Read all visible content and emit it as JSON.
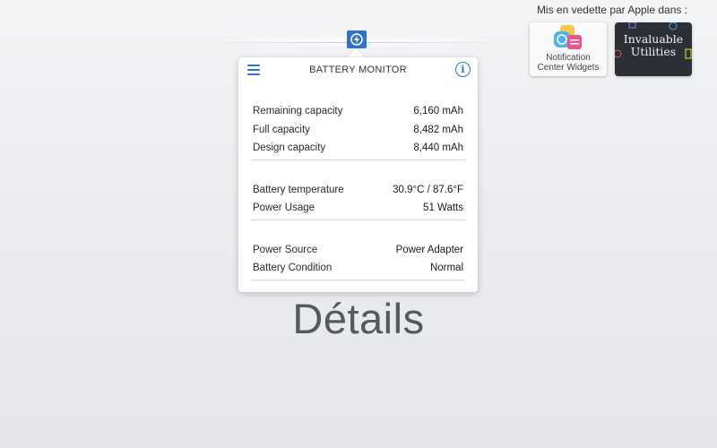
{
  "app": {
    "title": "BATTERY MONITOR",
    "accent_color": "#2f73c9",
    "menu_icon": "hamburger-icon",
    "info_icon": "info-icon",
    "status_icon": "battery-bolt-icon"
  },
  "groups": [
    {
      "rows": [
        {
          "label": "Remaining capacity",
          "value": "6,160 mAh"
        },
        {
          "label": "Full capacity",
          "value": "8,482 mAh"
        },
        {
          "label": "Design capacity",
          "value": "8,440 mAh"
        }
      ]
    },
    {
      "rows": [
        {
          "label": "Battery temperature",
          "value": "30.9°C / 87.6°F"
        },
        {
          "label": "Power Usage",
          "value": "51 Watts"
        }
      ]
    },
    {
      "rows": [
        {
          "label": "Power Source",
          "value": "Power Adapter"
        },
        {
          "label": "Battery Condition",
          "value": "Normal"
        }
      ]
    }
  ],
  "heading": "Détails",
  "featured": {
    "label": "Mis en vedette par Apple dans :",
    "badges": [
      {
        "line1": "Notification",
        "line2": "Center Widgets"
      },
      {
        "line1": "Invaluable",
        "line2": "Utilities"
      }
    ]
  }
}
